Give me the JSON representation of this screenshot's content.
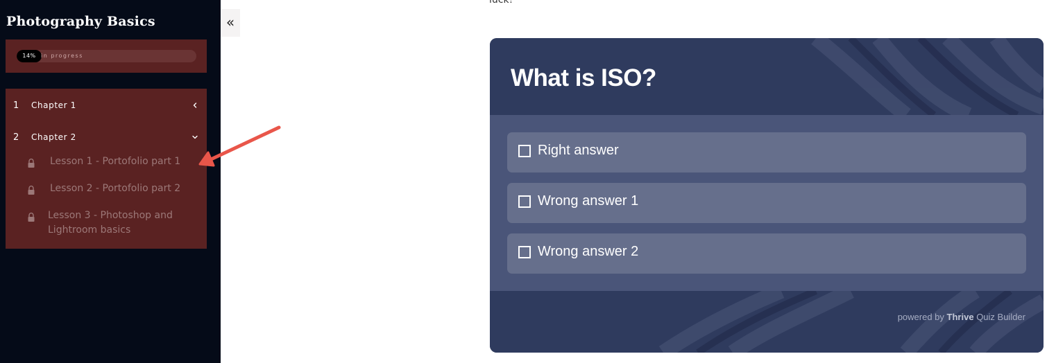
{
  "sidebar": {
    "course_title": "Photography Basics",
    "progress": {
      "percent_label": "14%",
      "percent_value": 14,
      "status": "in progress"
    },
    "chapters": [
      {
        "number": "1",
        "title": "Chapter 1",
        "expanded": false
      },
      {
        "number": "2",
        "title": "Chapter 2",
        "expanded": true,
        "lessons": [
          {
            "title": "Lesson 1 - Portofolio part 1",
            "locked": true
          },
          {
            "title": "Lesson 2 - Portofolio part 2",
            "locked": true
          },
          {
            "title": "Lesson 3 - Photoshop and Lightroom basics",
            "locked": true
          }
        ]
      }
    ],
    "collapse_label": "«"
  },
  "content": {
    "prev_text_fragment": "luck!",
    "quiz": {
      "question": "What is ISO?",
      "answers": [
        {
          "label": "Right answer",
          "checked": false
        },
        {
          "label": "Wrong answer 1",
          "checked": false
        },
        {
          "label": "Wrong answer 2",
          "checked": false
        }
      ],
      "powered_prefix": "powered by",
      "powered_brand": "Thrive",
      "powered_product": "Quiz Builder"
    }
  },
  "colors": {
    "sidebar_bg": "#050b18",
    "panel_bg": "#5a2222",
    "quiz_bg": "#2f3b5e",
    "answer_bg": "#666f8c",
    "annotation_arrow": "#e9564a"
  },
  "icons": {
    "collapse": "double-chevron-left-icon",
    "chapter_collapsed": "chevron-left-icon",
    "chapter_expanded": "chevron-down-icon",
    "lesson_locked": "lock-icon"
  }
}
